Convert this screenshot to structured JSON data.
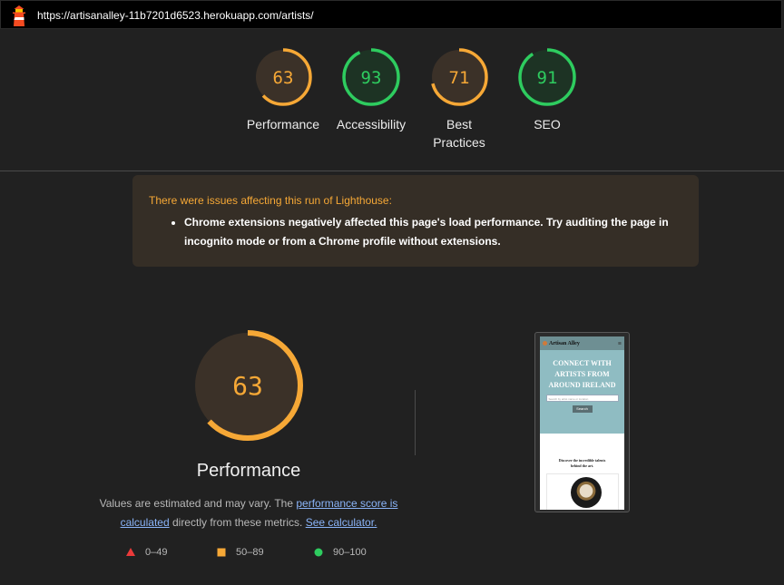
{
  "header": {
    "url": "https://artisanalley-11b7201d6523.herokuapp.com/artists/"
  },
  "colors": {
    "average": "#f6a836",
    "average_bg": "#3b3128",
    "pass": "#2ecc5f",
    "pass_bg": "#1d3324",
    "fail": "#eb3a3a"
  },
  "categories": [
    {
      "label": "Performance",
      "score": 63,
      "rating": "average"
    },
    {
      "label": "Accessibility",
      "score": 93,
      "rating": "pass"
    },
    {
      "label": "Best Practices",
      "score": 71,
      "rating": "average"
    },
    {
      "label": "SEO",
      "score": 91,
      "rating": "pass"
    }
  ],
  "warning": {
    "title": "There were issues affecting this run of Lighthouse:",
    "items": [
      "Chrome extensions negatively affected this page's load performance. Try auditing the page in incognito mode or from a Chrome profile without extensions."
    ]
  },
  "performance": {
    "score": 63,
    "rating": "average",
    "title": "Performance",
    "desc_prefix": "Values are estimated and may vary. The ",
    "desc_link1": "performance score is calculated",
    "desc_middle": " directly from these metrics. ",
    "desc_link2": "See calculator."
  },
  "legend": [
    {
      "range": "0–49",
      "icon": "triangle-icon",
      "color": "#eb3a3a"
    },
    {
      "range": "50–89",
      "icon": "square-icon",
      "color": "#f6a836"
    },
    {
      "range": "90–100",
      "icon": "circle-icon",
      "color": "#2ecc5f"
    }
  ],
  "screenshot": {
    "brand": "Artisan Alley",
    "hero": "CONNECT WITH ARTISTS FROM AROUND IRELAND",
    "search_placeholder": "Search by artist name or location",
    "search_button": "Search",
    "discover": "Discover the incredible talents behind the art."
  }
}
